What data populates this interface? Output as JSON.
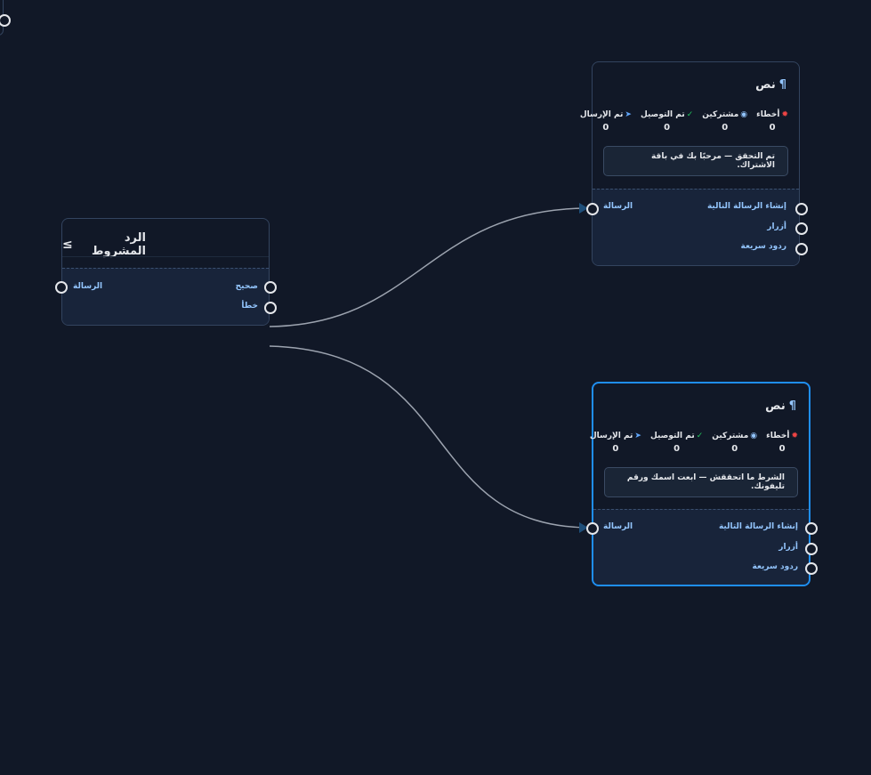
{
  "colors": {
    "background": "#111827",
    "accent": "#1f8ef1",
    "port_label": "#93c5fd",
    "error": "#ef4444",
    "success": "#22c55e",
    "edge": "#9ca3af"
  },
  "condition_node": {
    "title": "الرد المشروط",
    "icon": "greater-equal-icon",
    "input_label": "الرسالة",
    "true_label": "صحيح",
    "false_label": "خطأ"
  },
  "text_nodes": [
    {
      "title": "نص",
      "icon": "pilcrow-icon",
      "stats": [
        {
          "label": "أخطاء",
          "value": "0",
          "icon": "bug-icon"
        },
        {
          "label": "مشتركين",
          "value": "0",
          "icon": "user-circle-icon"
        },
        {
          "label": "تم التوصيل",
          "value": "0",
          "icon": "check-circle-icon"
        },
        {
          "label": "تم الإرسال",
          "value": "0",
          "icon": "send-icon"
        }
      ],
      "message": "تم التحقق — مرحبًا بك في باقة الاشتراك.",
      "input_label": "الرسالة",
      "outputs": [
        "إنشاء الرسالة التالية",
        "أزرار",
        "ردود سريعة"
      ]
    },
    {
      "title": "نص",
      "icon": "pilcrow-icon",
      "stats": [
        {
          "label": "أخطاء",
          "value": "0",
          "icon": "bug-icon"
        },
        {
          "label": "مشتركين",
          "value": "0",
          "icon": "user-circle-icon"
        },
        {
          "label": "تم التوصيل",
          "value": "0",
          "icon": "check-circle-icon"
        },
        {
          "label": "تم الإرسال",
          "value": "0",
          "icon": "send-icon"
        }
      ],
      "message": "الشرط ما اتحققش — ابعت اسمك ورقم تليفونك.",
      "input_label": "الرسالة",
      "outputs": [
        "إنشاء الرسالة التالية",
        "أزرار",
        "ردود سريعة"
      ]
    }
  ]
}
